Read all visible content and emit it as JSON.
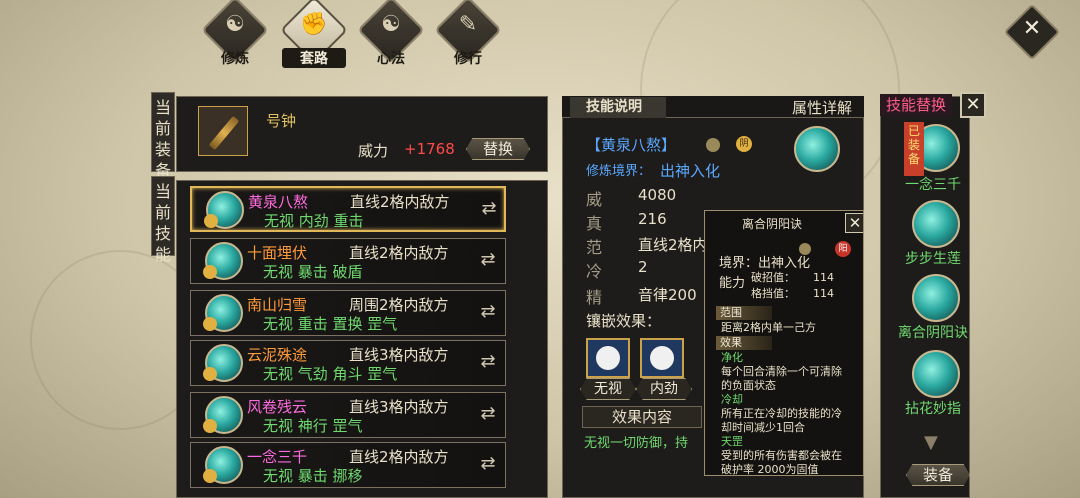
{
  "nav": {
    "tabs": [
      {
        "label": "修炼",
        "glyph": "☯",
        "icon": "cultivate-icon"
      },
      {
        "label": "套路",
        "glyph": "✊",
        "icon": "fist-icon"
      },
      {
        "label": "心法",
        "glyph": "☯",
        "icon": "taiji-icon"
      },
      {
        "label": "修行",
        "glyph": "✎",
        "icon": "brush-icon"
      }
    ],
    "close_glyph": "✕"
  },
  "equipment": {
    "side_label": "当前装备",
    "name": "号钟",
    "power_label": "威力",
    "power_delta": "+1768",
    "swap_button": "替换"
  },
  "skills_panel": {
    "side_label": "当前技能",
    "rows": [
      {
        "name": "黄泉八熬",
        "name_color": "#ff6adf",
        "range": "直线2格内敌方",
        "tags": "无视  内劲  重击",
        "selected": true
      },
      {
        "name": "十面埋伏",
        "name_color": "#ff9a3a",
        "range": "直线2格内敌方",
        "tags": "无视  暴击  破盾",
        "selected": false
      },
      {
        "name": "南山归雪",
        "name_color": "#ff9a3a",
        "range": "周围2格内敌方",
        "tags": "无视  重击  置换  罡气",
        "selected": false
      },
      {
        "name": "云泥殊途",
        "name_color": "#ff9a3a",
        "range": "直线3格内敌方",
        "tags": "无视  气劲  角斗  罡气",
        "selected": false
      },
      {
        "name": "风卷残云",
        "name_color": "#ff6adf",
        "range": "直线3格内敌方",
        "tags": "无视  神行  罡气",
        "selected": false
      },
      {
        "name": "一念三千",
        "name_color": "#ff6adf",
        "range": "直线2格内敌方",
        "tags": "无视  暴击  挪移",
        "selected": false
      }
    ]
  },
  "detail": {
    "tab_active": "技能说明",
    "tab_other": "属性详解",
    "skill_name": "【黄泉八熬】",
    "realm_label": "修炼境界：",
    "realm_value": "出神入化",
    "yin_badge": "阴",
    "stats": [
      {
        "label": "威",
        "value": "4080"
      },
      {
        "label": "真",
        "value": "216"
      },
      {
        "label": "范",
        "value": "直线2格内"
      },
      {
        "label": "冷",
        "value": "2"
      },
      {
        "label": "精",
        "value": "音律200"
      }
    ],
    "inlay_label": "镶嵌效果：",
    "slots": [
      "无视",
      "内劲"
    ],
    "effect_tab": "效果内容",
    "effect_text": "无视一切防御，持"
  },
  "popup": {
    "title": "离合阴阳诀",
    "close": "✕",
    "yang_badge": "阳",
    "realm": "境界：出神入化",
    "ability_label": "能力",
    "break_label": "破招值：",
    "break_value": "114",
    "parry_label": "格挡值：",
    "parry_value": "114",
    "range_title": "范围",
    "range_text": "距离2格内单一己方",
    "effect_title": "效果",
    "purify_title": "净化",
    "purify_text": "每个回合清除一个可清除的负面状态",
    "cooldown_title": "冷却",
    "cooldown_text": "所有正在冷却的技能的冷却时间减少1回合",
    "shield_title": "天罡",
    "shield_text": "受到的所有伤害都会被在破护率  2000为固值"
  },
  "replace_panel": {
    "title": "技能替换",
    "close": "✕",
    "equipped_tag": "已装备",
    "skills": [
      {
        "name": "一念三千"
      },
      {
        "name": "步步生莲"
      },
      {
        "name": "离合阴阳诀"
      },
      {
        "name": "拈花妙指"
      }
    ],
    "equip_button": "装备"
  }
}
